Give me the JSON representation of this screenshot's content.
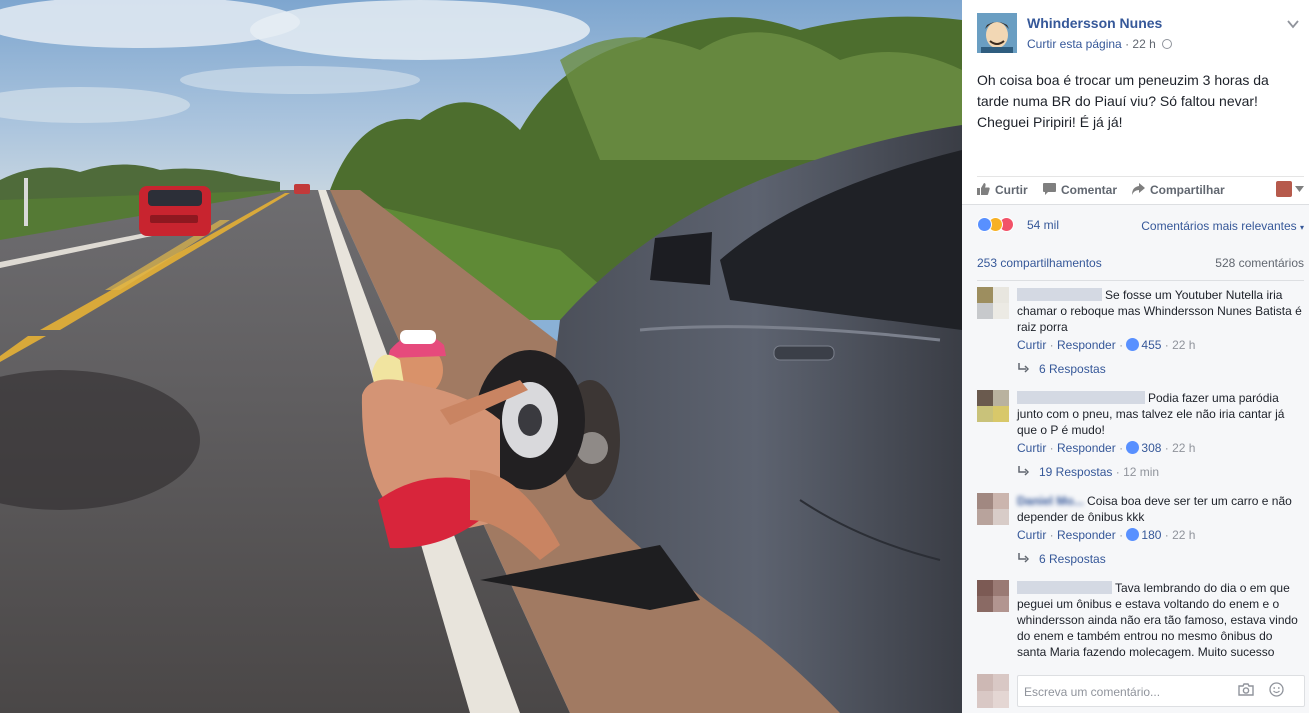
{
  "post": {
    "page_name": "Whindersson Nunes",
    "like_page": "Curtir esta página",
    "time": "22 h",
    "text": "Oh coisa boa é trocar um peneuzim 3 horas da tarde numa BR do Piauí viu? Só faltou nevar! Cheguei Piripiri! É já já!"
  },
  "actions": {
    "like": "Curtir",
    "comment": "Comentar",
    "share": "Compartilhar"
  },
  "stats": {
    "reactions": "54 mil",
    "sort": "Comentários mais relevantes",
    "shares": "253 compartilhamentos",
    "comments": "528 comentários"
  },
  "comments": [
    {
      "name": "",
      "text": "Se fosse um Youtuber Nutella iria chamar o reboque mas Whindersson Nunes Batista é raiz porra",
      "like": "Curtir",
      "reply": "Responder",
      "likes": "455",
      "time": "22 h",
      "replies": "6 Respostas",
      "replies_time": ""
    },
    {
      "name": "",
      "text": "Podia fazer uma paródia junto com o pneu, mas talvez ele não iria cantar já que o P é mudo!",
      "like": "Curtir",
      "reply": "Responder",
      "likes": "308",
      "time": "22 h",
      "replies": "19 Respostas",
      "replies_time": "12 min"
    },
    {
      "name": "Daniel Mo...",
      "text": "Coisa boa deve ser ter um carro e não depender de ônibus kkk",
      "like": "Curtir",
      "reply": "Responder",
      "likes": "180",
      "time": "22 h",
      "replies": "6 Respostas",
      "replies_time": ""
    },
    {
      "name": "",
      "text": "Tava lembrando do dia o em que peguei um ônibus e estava voltando do enem e o whindersson ainda não era tão famoso, estava vindo do enem e também entrou no mesmo ônibus do santa Maria fazendo molecagem. Muito sucesso"
    }
  ],
  "compose": {
    "placeholder": "Escreva um comentário..."
  },
  "colors": {
    "link": "#365899",
    "like_blue": "#5890ff",
    "love_red": "#f25268",
    "haha_yellow": "#f7b125"
  },
  "icons": {
    "options": "chevron-down-icon",
    "privacy": "globe-icon",
    "like": "thumbs-up-icon",
    "comment": "speech-bubble-icon",
    "share": "share-arrow-icon",
    "reply": "reply-arrow-icon",
    "camera": "camera-icon",
    "emoji": "smiley-icon"
  }
}
